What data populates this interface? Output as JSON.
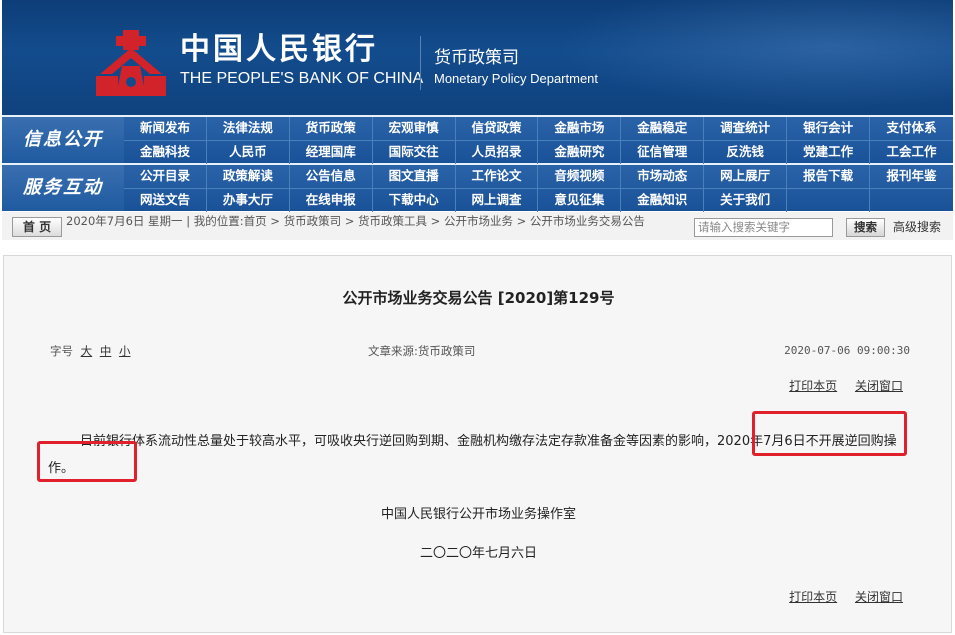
{
  "header": {
    "bank_name_cn": "中国人民银行",
    "bank_name_en": "THE PEOPLE'S BANK OF CHINA",
    "dept_cn": "货币政策司",
    "dept_en": "Monetary Policy Department"
  },
  "nav": {
    "section1_label": "信息公开",
    "section2_label": "服务互动",
    "section1_rows": [
      [
        "新闻发布",
        "法律法规",
        "货币政策",
        "宏观审慎",
        "信贷政策",
        "金融市场",
        "金融稳定",
        "调查统计",
        "银行会计",
        "支付体系"
      ],
      [
        "金融科技",
        "人民币",
        "经理国库",
        "国际交往",
        "人员招录",
        "金融研究",
        "征信管理",
        "反洗钱",
        "党建工作",
        "工会工作"
      ]
    ],
    "section2_rows": [
      [
        "公开目录",
        "政策解读",
        "公告信息",
        "图文直播",
        "工作论文",
        "音频视频",
        "市场动态",
        "网上展厅",
        "报告下载",
        "报刊年鉴"
      ],
      [
        "网送文告",
        "办事大厅",
        "在线申报",
        "下载中心",
        "网上调查",
        "意见征集",
        "金融知识",
        "关于我们",
        "",
        ""
      ]
    ]
  },
  "breadcrumb": {
    "home_label": "首 页",
    "date_text": "2020年7月6日 星期一",
    "location_prefix": "我的位置:",
    "path": [
      "首页",
      "货币政策司",
      "货币政策工具",
      "公开市场业务",
      "公开市场业务交易公告"
    ],
    "path_display": "首页 > 货币政策司 > 货币政策工具 > 公开市场业务 > 公开市场业务交易公告",
    "search_placeholder": "请输入搜索关键字",
    "search_button": "搜索",
    "advanced_search": "高级搜索"
  },
  "article": {
    "title": "公开市场业务交易公告 [2020]第129号",
    "font_size_label": "字号",
    "font_size_options": [
      "大",
      "中",
      "小"
    ],
    "source_text": "文章来源:货币政策司",
    "publish_time": "2020-07-06 09:00:30",
    "print_label": "打印本页",
    "close_label": "关闭窗口",
    "body": "目前银行体系流动性总量处于较高水平，可吸收央行逆回购到期、金融机构缴存法定存款准备金等因素的影响，2020年7月6日不开展逆回购操作。",
    "signer": "中国人民银行公开市场业务操作室",
    "sign_date": "二〇二〇年七月六日"
  },
  "colors": {
    "banner_blue": "#134c8d",
    "nav_blue": "#1f5aa0",
    "highlight_red": "#e0202a"
  }
}
